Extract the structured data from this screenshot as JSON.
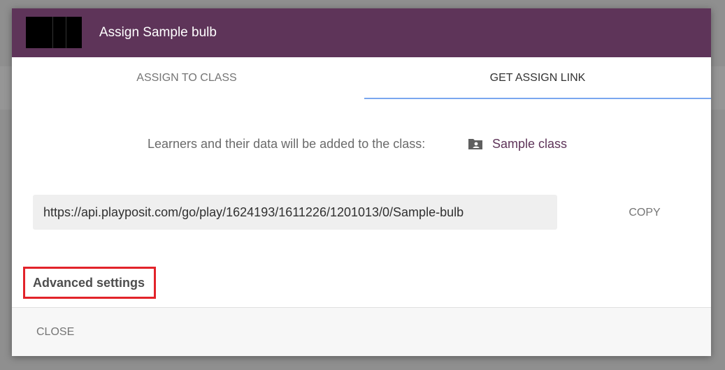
{
  "modal": {
    "title": "Assign Sample bulb"
  },
  "tabs": [
    {
      "label": "ASSIGN TO CLASS",
      "active": false
    },
    {
      "label": "GET ASSIGN LINK",
      "active": true
    }
  ],
  "info": {
    "text": "Learners and their data will be added to the class:",
    "icon": "folder-account-icon",
    "class_name": "Sample class"
  },
  "link": {
    "url": "https://api.playposit.com/go/play/1624193/1611226/1201013/0/Sample-bulb",
    "copy_label": "COPY"
  },
  "advanced": {
    "label": "Advanced settings"
  },
  "footer": {
    "close_label": "CLOSE"
  },
  "colors": {
    "header": "#5e3459",
    "accent_text": "#5e3459",
    "tab_indicator": "#7aa7ef",
    "highlight_box": "#e2232a",
    "backdrop": "#8f8f8f"
  }
}
